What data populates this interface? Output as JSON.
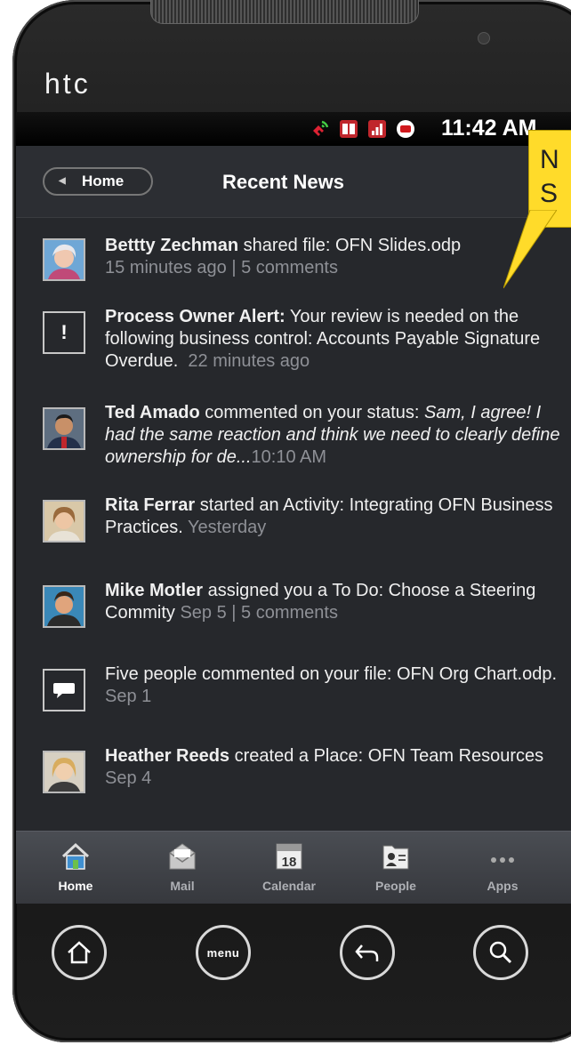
{
  "device": {
    "brand": "htc"
  },
  "status_bar": {
    "time": "11:42 AM"
  },
  "header": {
    "back_label": "Home",
    "title": "Recent News"
  },
  "callout": {
    "text_line1": "N",
    "text_line2": "S"
  },
  "feed": [
    {
      "actor": "Bettty Zechman",
      "text": " shared file: OFN Slides.odp",
      "meta": "15 minutes ago | 5 comments",
      "thumb": "avatar"
    },
    {
      "actor": "Process Owner Alert:",
      "text": " Your review is needed on the following business control: Accounts Payable Signature Overdue.",
      "meta": "22 minutes ago",
      "thumb": "alert-icon"
    },
    {
      "actor": "Ted Amado",
      "text": " commented on your status: ",
      "quote": "Sam, I agree! I had the same reaction and think we need to clearly define ownership for de...",
      "meta": "10:10 AM",
      "thumb": "avatar"
    },
    {
      "actor": "Rita Ferrar",
      "text": " started an Activity: Integrating OFN Business Practices.",
      "meta": "Yesterday",
      "thumb": "avatar"
    },
    {
      "actor": "Mike Motler",
      "text": " assigned you a To Do: Choose a Steering Commity",
      "meta": "Sep 5 | 5 comments",
      "thumb": "avatar"
    },
    {
      "actor": "",
      "text": "Five people commented on your file: OFN Org Chart.odp.",
      "meta": "Sep 1",
      "thumb": "comment-icon"
    },
    {
      "actor": "Heather Reeds",
      "text": " created a Place: OFN Team Resources",
      "meta": "Sep 4",
      "thumb": "avatar"
    }
  ],
  "tabs": [
    {
      "label": "Home",
      "icon": "home-icon",
      "active": true
    },
    {
      "label": "Mail",
      "icon": "mail-icon"
    },
    {
      "label": "Calendar",
      "icon": "calendar-icon",
      "day": "18"
    },
    {
      "label": "People",
      "icon": "people-icon"
    },
    {
      "label": "Apps",
      "icon": "apps-icon"
    }
  ],
  "hardware_keys": {
    "menu_label": "menu"
  },
  "colors": {
    "screen_bg": "#26282c",
    "meta_text": "#8e9096",
    "callout": "#ffdb2a"
  }
}
